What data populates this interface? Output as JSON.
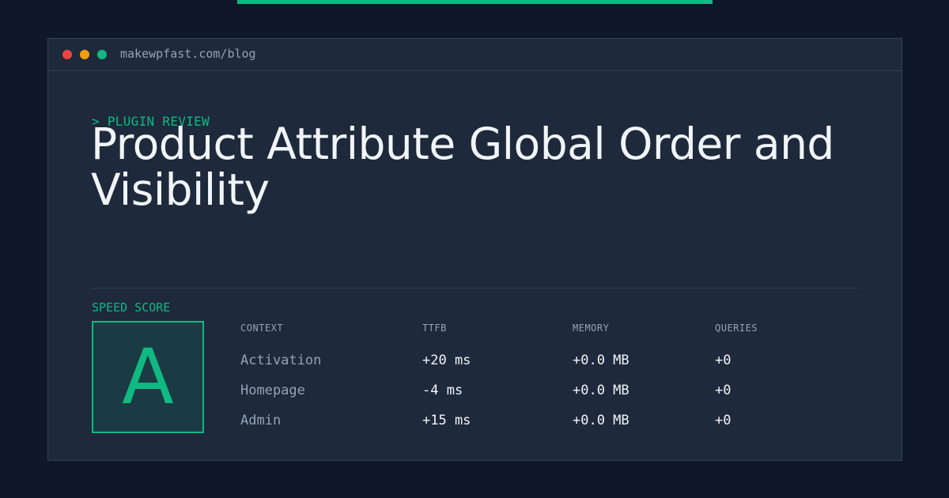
{
  "colors": {
    "background": "#0f172a",
    "window": "#1e293b",
    "accent": "#10b981",
    "text": "#f1f5f9",
    "muted": "#94a3b8",
    "border": "#334155"
  },
  "window": {
    "url": "makewpfast.com/blog"
  },
  "post": {
    "kicker": "> PLUGIN REVIEW",
    "title": "Product Attribute Global Order and Visibility"
  },
  "score": {
    "label": "SPEED SCORE",
    "grade": "A"
  },
  "metrics": {
    "columns": [
      "CONTEXT",
      "TTFB",
      "MEMORY",
      "QUERIES"
    ],
    "rows": [
      [
        "Activation",
        "+20 ms",
        "+0.0 MB",
        "+0"
      ],
      [
        "Homepage",
        "-4 ms",
        "+0.0 MB",
        "+0"
      ],
      [
        "Admin",
        "+15 ms",
        "+0.0 MB",
        "+0"
      ]
    ]
  }
}
